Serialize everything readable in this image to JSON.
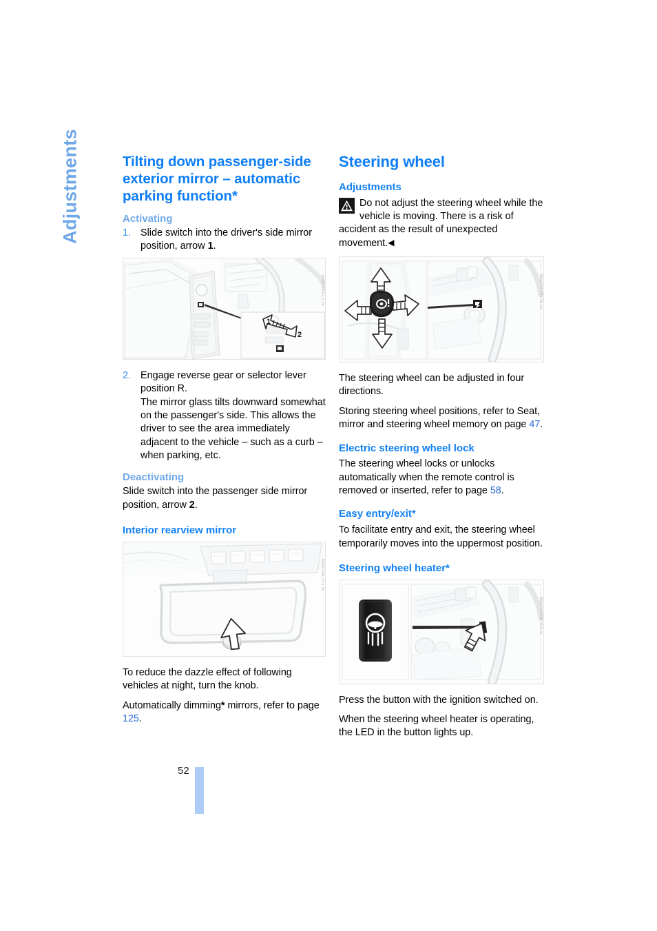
{
  "page": {
    "number": "52",
    "side_tab": "Adjustments",
    "accent_blue": "#0d7ef5",
    "pale_blue": "#6fa8e8",
    "link_blue": "#2a6bd8",
    "page_bar_color": "#aecbf5"
  },
  "left_column": {
    "heading": "Tilting down passenger-side exterior mirror – automatic parking function*",
    "activating_heading": "Activating",
    "step1": {
      "number": "1.",
      "text_a": "Slide switch into the driver's side mirror position, arrow ",
      "bold": "1",
      "text_b": "."
    },
    "figure1": {
      "id": "BMWT7ZA3_0.fm",
      "caption_labels": [
        "1",
        "2"
      ]
    },
    "step2": {
      "number": "2.",
      "text": "Engage reverse gear or selector lever position R.\nThe mirror glass tilts downward somewhat on the passenger's side. This allows the driver to see the area immediately adjacent to the vehicle – such as a curb – when parking, etc."
    },
    "deactivating_heading": "Deactivating",
    "deactivating_text_a": "Slide switch into the passenger side mirror position, arrow ",
    "deactivating_bold": "2",
    "deactivating_text_b": ".",
    "interior_mirror_heading": "Interior rearview mirror",
    "figure2": {
      "id": "BMW7WRL0T9.fm"
    },
    "interior_text_1": "To reduce the dazzle effect of following vehicles at night, turn the knob.",
    "interior_text_2a": "Automatically dimming",
    "interior_text_2b": " mirrors, refer to page ",
    "interior_text_ref": "125",
    "interior_text_2c": "."
  },
  "right_column": {
    "heading": "Steering wheel",
    "adjustments_heading": "Adjustments",
    "warning_text_a": "Do not adjust the steering wheel while the vehicle is moving. There is a risk of accident as the result of unexpected movement.",
    "warning_end_marker": "◀",
    "figure3": {
      "id": "BMW7V1-B1CT5.fm"
    },
    "body_1": "The steering wheel can be adjusted in four directions.",
    "body_2a": "Storing steering wheel positions, refer to Seat, mirror and steering wheel memory on page ",
    "body_2_ref": "47",
    "body_2b": ".",
    "lock_heading": "Electric steering wheel lock",
    "lock_text_a": "The steering wheel locks or unlocks automatically when the remote control is removed or inserted, refer to page ",
    "lock_text_ref": "58",
    "lock_text_b": ".",
    "easy_heading": "Easy entry/exit*",
    "easy_text": "To facilitate entry and exit, the steering wheel temporarily moves into the uppermost position.",
    "heater_heading": "Steering wheel heater*",
    "figure4": {
      "id": "BMW7WASHP1FA.fm"
    },
    "heater_text_1": "Press the button with the ignition switched on.",
    "heater_text_2": "When the steering wheel heater is operating, the LED in the button lights up."
  }
}
